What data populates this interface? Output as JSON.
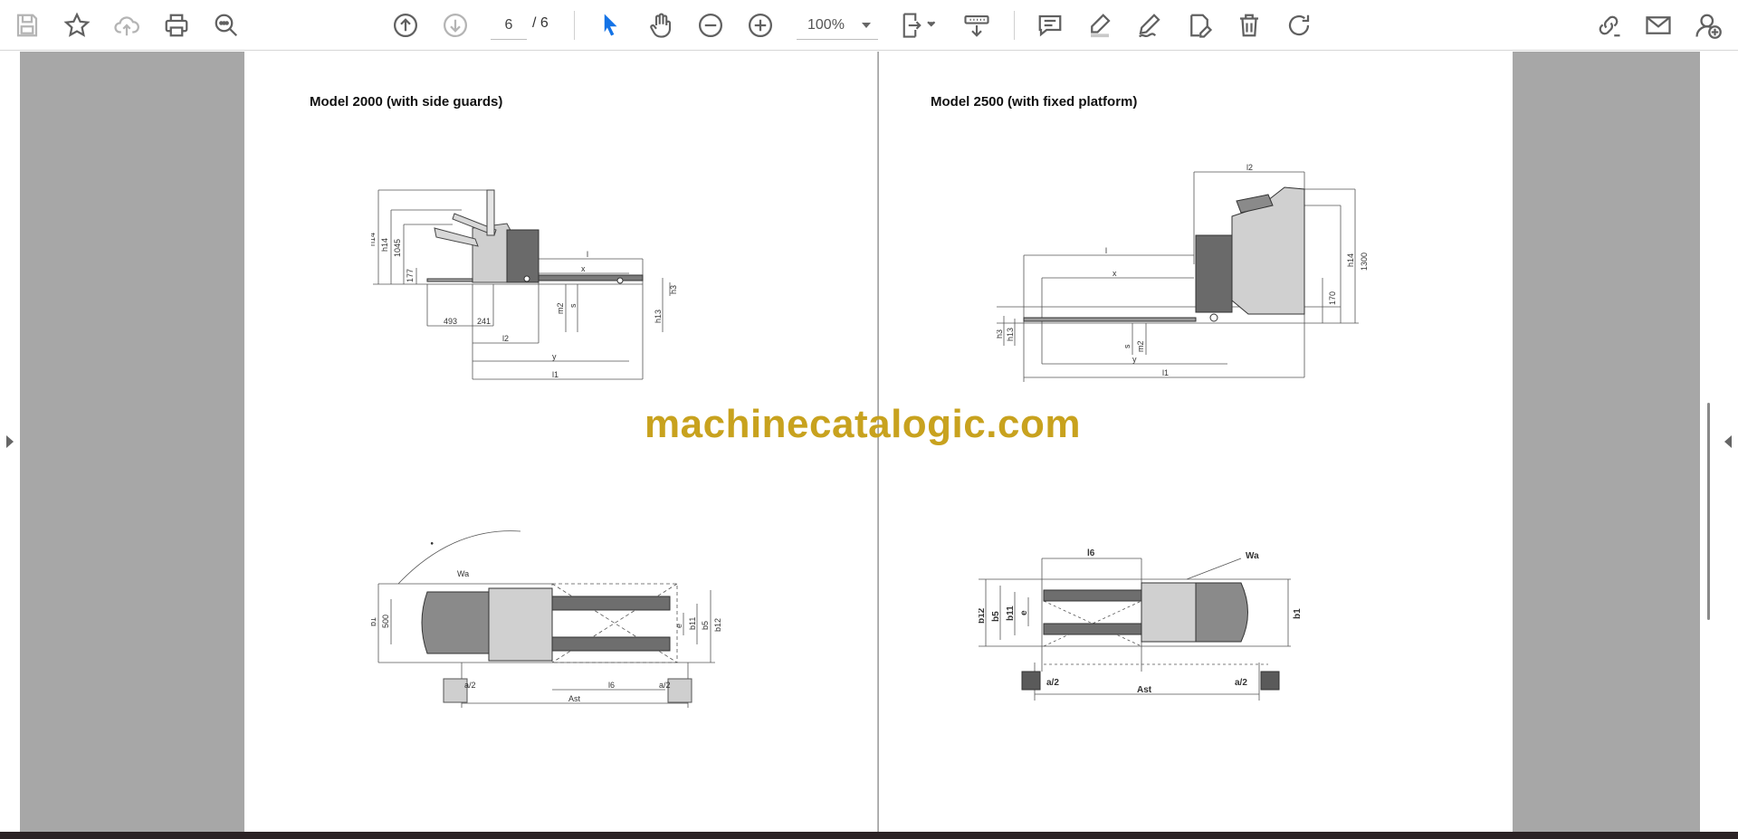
{
  "toolbar": {
    "current_page": "6",
    "page_total": "/ 6",
    "zoom": "100%",
    "icons": [
      "save-icon",
      "bookmark-star-icon",
      "upload-cloud-icon",
      "print-icon",
      "find-zoom-icon",
      "page-up-icon",
      "page-down-icon",
      "select-pointer-icon",
      "pan-hand-icon",
      "zoom-out-icon",
      "zoom-in-icon",
      "fit-page-icon",
      "read-mode-icon",
      "comment-icon",
      "highlight-icon",
      "draw-icon",
      "sign-icon",
      "delete-icon",
      "rotate-icon",
      "edit-link-icon",
      "email-icon",
      "share-user-icon"
    ],
    "accent": "#1473e6"
  },
  "document": {
    "left_page": {
      "title": "Model 2000 (with side guards)",
      "side_view_labels": {
        "h14a": "h14",
        "h14b": "h14",
        "d1045": "1045",
        "d177": "177",
        "d493": "493",
        "d241": "241",
        "l2": "l2",
        "l": "l",
        "x": "x",
        "y": "y",
        "l1": "l1",
        "m2": "m2",
        "s": "s",
        "h3": "h3",
        "h13": "h13"
      },
      "top_view_labels": {
        "wa": "Wa",
        "b1": "b1",
        "d500": "500",
        "b5": "b5",
        "b11": "b11",
        "b12": "b12",
        "e": "e",
        "a2a": "a/2",
        "a2b": "a/2",
        "l6": "l6",
        "ast": "Ast"
      }
    },
    "right_page": {
      "title": "Model 2500 (with fixed platform)",
      "side_view_labels": {
        "l2": "l2",
        "l": "l",
        "x": "x",
        "y": "y",
        "l1": "l1",
        "h14": "h14",
        "d1300": "1300",
        "d170": "170",
        "h3": "h3",
        "h13": "h13",
        "s": "s",
        "m2": "m2"
      },
      "top_view_labels": {
        "l6": "l6",
        "wa": "Wa",
        "b12": "b12",
        "b5": "b5",
        "b11": "b11",
        "e": "e",
        "b1": "b1",
        "a2a": "a/2",
        "a2b": "a/2",
        "ast": "Ast"
      }
    }
  },
  "watermark": "machinecatalogic.com",
  "colors": {
    "canvas": "#a7a7a7",
    "watermark": "#c8a21e",
    "icon": "#606060",
    "accent": "#1473e6"
  }
}
